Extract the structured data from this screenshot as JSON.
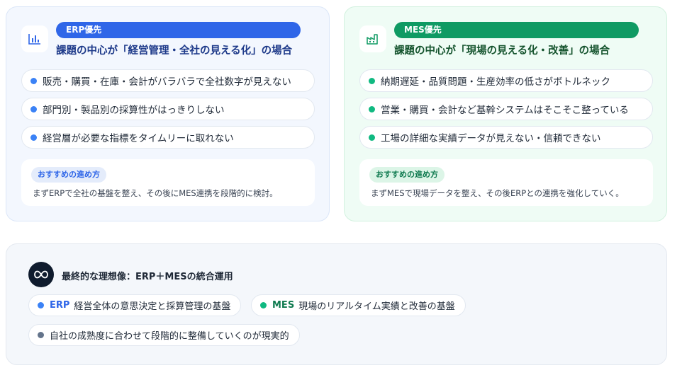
{
  "erp": {
    "icon": "bar-chart-icon",
    "badge": "ERP優先",
    "heading": "課題の中心が「経営管理・全社の見える化」の場合",
    "items": [
      "販売・購買・在庫・会計がバラバラで全社数字が見えない",
      "部門別・製品別の採算性がはっきりしない",
      "経営層が必要な指標をタイムリーに取れない"
    ],
    "rec_tag": "おすすめの進め方",
    "rec_text": "まずERPで全社の基盤を整え、その後にMES連携を段階的に検討。"
  },
  "mes": {
    "icon": "factory-icon",
    "badge": "MES優先",
    "heading": "課題の中心が「現場の見える化・改善」の場合",
    "items": [
      "納期遅延・品質問題・生産効率の低さがボトルネック",
      "営業・購買・会計など基幹システムはそこそこ整っている",
      "工場の詳細な実績データが見えない・信頼できない"
    ],
    "rec_tag": "おすすめの進め方",
    "rec_text": "まずMESで現場データを整え、その後ERPとの連携を強化していく。"
  },
  "final": {
    "icon": "infinity-icon",
    "title": "最終的な理想像：ERP＋MESの統合運用",
    "erp_label": "ERP",
    "erp_text": "経営全体の意思決定と採算管理の基盤",
    "mes_label": "MES",
    "mes_text": "現場のリアルタイム実績と改善の基盤",
    "note": "自社の成熟度に合わせて段階的に整備していくのが現実的"
  },
  "colors": {
    "erp_accent": "#2f66e8",
    "mes_accent": "#0f9a63",
    "erp_dot": "#3b82f6",
    "mes_dot": "#10b981"
  }
}
